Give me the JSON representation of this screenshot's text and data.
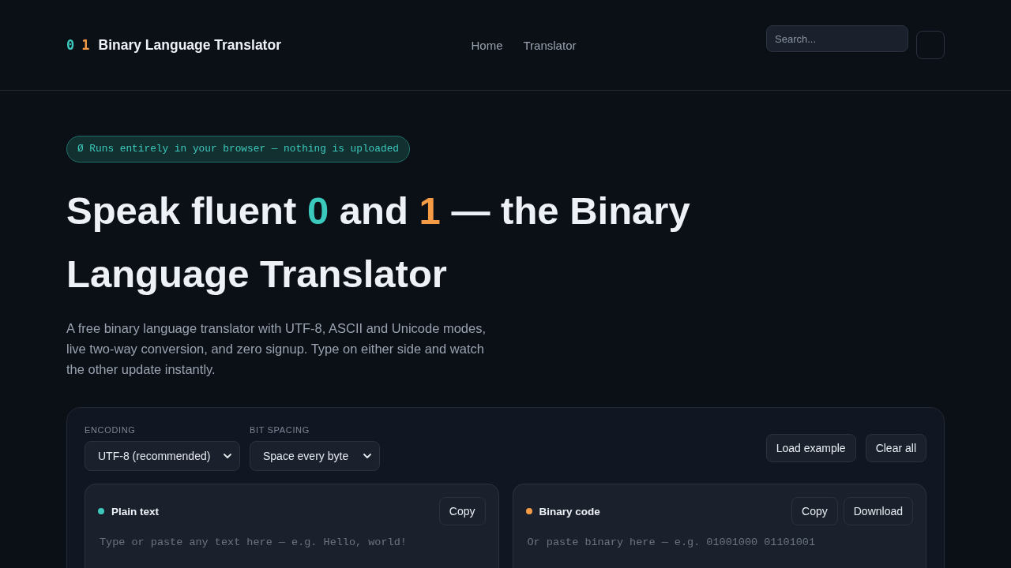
{
  "header": {
    "logo": {
      "digit_zero": "0",
      "digit_one": "1",
      "name": "Binary Language Translator"
    },
    "nav": [
      {
        "label": "Home"
      },
      {
        "label": "Translator"
      }
    ],
    "search": {
      "placeholder": "Search..."
    }
  },
  "badge": "Ø Runs entirely in your browser — nothing is uploaded",
  "hero": {
    "heading": [
      {
        "text": "Speak fluent ",
        "kind": "plain"
      },
      {
        "text": "0",
        "kind": "zero"
      },
      {
        "text": " and ",
        "kind": "plain"
      },
      {
        "text": "1",
        "kind": "one"
      },
      {
        "text": " — the Binary Language Translator",
        "kind": "plain"
      }
    ],
    "description": "A free binary language translator with UTF‑8, ASCII and Unicode modes, live two‑way conversion, and zero signup. Type on either side and watch the other update instantly."
  },
  "translator": {
    "settings": [
      {
        "label": "ENCODING",
        "value": "UTF‑8 (recommended)"
      },
      {
        "label": "BIT SPACING",
        "value": "Space every byte"
      }
    ],
    "actions": [
      "Load example",
      "Clear all"
    ],
    "panels": [
      {
        "title": "Plain text",
        "color": "#3cc9bd",
        "buttons": [
          "Copy"
        ],
        "placeholder": "Type or paste any text here — e.g. Hello, world!"
      },
      {
        "title": "Binary code",
        "color": "#f59a45",
        "buttons": [
          "Copy",
          "Download"
        ],
        "placeholder": "Or paste binary here — e.g. 01001000 01101001"
      }
    ]
  }
}
